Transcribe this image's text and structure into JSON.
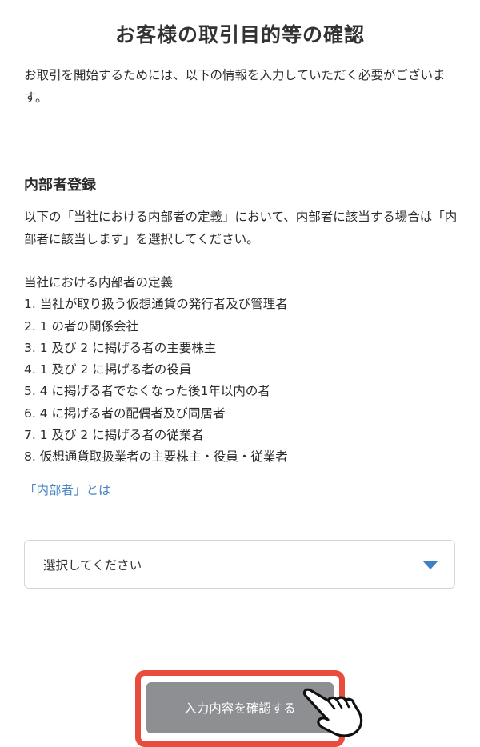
{
  "page": {
    "title": "お客様の取引目的等の確認",
    "intro": "お取引を開始するためには、以下の情報を入力していただく必要がございます。"
  },
  "insider_section": {
    "title": "内部者登録",
    "instruction": "以下の「当社における内部者の定義」において、内部者に該当する場合は「内部者に該当します」を選択してください。",
    "definition_title": "当社における内部者の定義",
    "definitions": [
      "1.  当社が取り扱う仮想通貨の発行者及び管理者",
      "2.  1 の者の関係会社",
      "3.  1 及び 2 に掲げる者の主要株主",
      "4.  1 及び 2 に掲げる者の役員",
      "5.  4 に掲げる者でなくなった後1年以内の者",
      "6.  4 に掲げる者の配偶者及び同居者",
      "7.  1 及び 2 に掲げる者の従業者",
      "8.  仮想通貨取扱業者の主要株主・役員・従業者"
    ],
    "insider_link": "「内部者」とは",
    "select": {
      "selected_value": "選択してください"
    }
  },
  "footer": {
    "confirm_button": "入力内容を確認する"
  },
  "colors": {
    "link": "#4a86c5",
    "button_bg": "#8e8f93",
    "highlight_frame": "#e74c3c",
    "select_arrow": "#3f7fc4"
  },
  "icons": {
    "dropdown": "triangle-down-icon",
    "pointer": "hand-pointer-icon"
  }
}
